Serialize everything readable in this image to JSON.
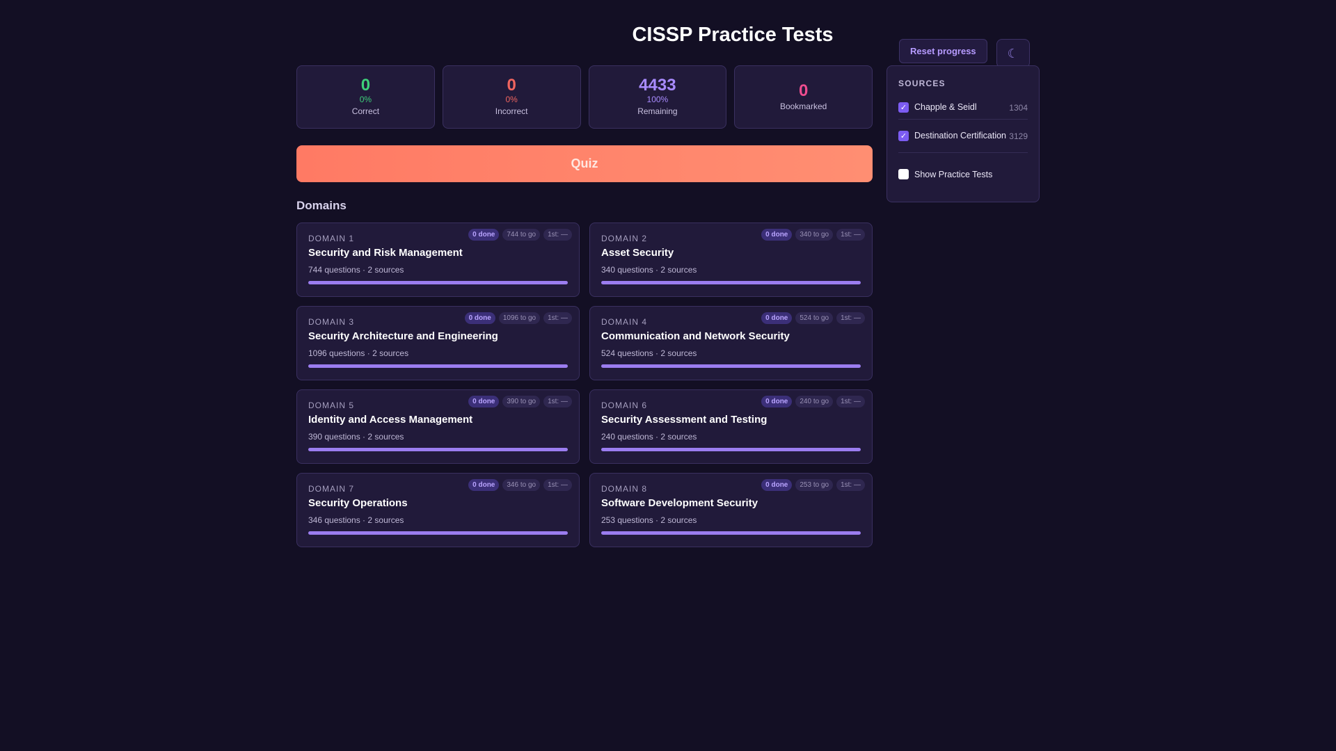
{
  "title": "CISSP Practice Tests",
  "reset_label": "Reset progress",
  "theme_icon": "☾",
  "stats": [
    {
      "value": "0",
      "pct": "0%",
      "label": "Correct",
      "color": "#3ecf7a"
    },
    {
      "value": "0",
      "pct": "0%",
      "label": "Incorrect",
      "color": "#f0655f"
    },
    {
      "value": "4433",
      "pct": "100%",
      "label": "Remaining",
      "color": "#a98bff"
    },
    {
      "value": "0",
      "pct": "",
      "label": "Bookmarked",
      "color": "#ee4d8f"
    }
  ],
  "quiz_label": "Quiz",
  "domains_heading": "Domains",
  "domains": [
    {
      "number": "DOMAIN 1",
      "name": "Security and Risk Management",
      "meta": "744 questions · 2 sources",
      "done": "0 done",
      "to_go": "744 to go",
      "first": "1st: —",
      "progress": 0
    },
    {
      "number": "DOMAIN 2",
      "name": "Asset Security",
      "meta": "340 questions · 2 sources",
      "done": "0 done",
      "to_go": "340 to go",
      "first": "1st: —",
      "progress": 0
    },
    {
      "number": "DOMAIN 3",
      "name": "Security Architecture and Engineering",
      "meta": "1096 questions · 2 sources",
      "done": "0 done",
      "to_go": "1096 to go",
      "first": "1st: —",
      "progress": 0
    },
    {
      "number": "DOMAIN 4",
      "name": "Communication and Network Security",
      "meta": "524 questions · 2 sources",
      "done": "0 done",
      "to_go": "524 to go",
      "first": "1st: —",
      "progress": 0
    },
    {
      "number": "DOMAIN 5",
      "name": "Identity and Access Management",
      "meta": "390 questions · 2 sources",
      "done": "0 done",
      "to_go": "390 to go",
      "first": "1st: —",
      "progress": 0
    },
    {
      "number": "DOMAIN 6",
      "name": "Security Assessment and Testing",
      "meta": "240 questions · 2 sources",
      "done": "0 done",
      "to_go": "240 to go",
      "first": "1st: —",
      "progress": 0
    },
    {
      "number": "DOMAIN 7",
      "name": "Security Operations",
      "meta": "346 questions · 2 sources",
      "done": "0 done",
      "to_go": "346 to go",
      "first": "1st: —",
      "progress": 0
    },
    {
      "number": "DOMAIN 8",
      "name": "Software Development Security",
      "meta": "253 questions · 2 sources",
      "done": "0 done",
      "to_go": "253 to go",
      "first": "1st: —",
      "progress": 0
    }
  ],
  "sources": {
    "title": "SOURCES",
    "items": [
      {
        "name": "Chapple & Seidl",
        "count": "1304",
        "checked": true
      },
      {
        "name": "Destination Certification",
        "count": "3129",
        "checked": true
      }
    ],
    "practice_label": "Show Practice Tests",
    "practice_checked": false
  }
}
